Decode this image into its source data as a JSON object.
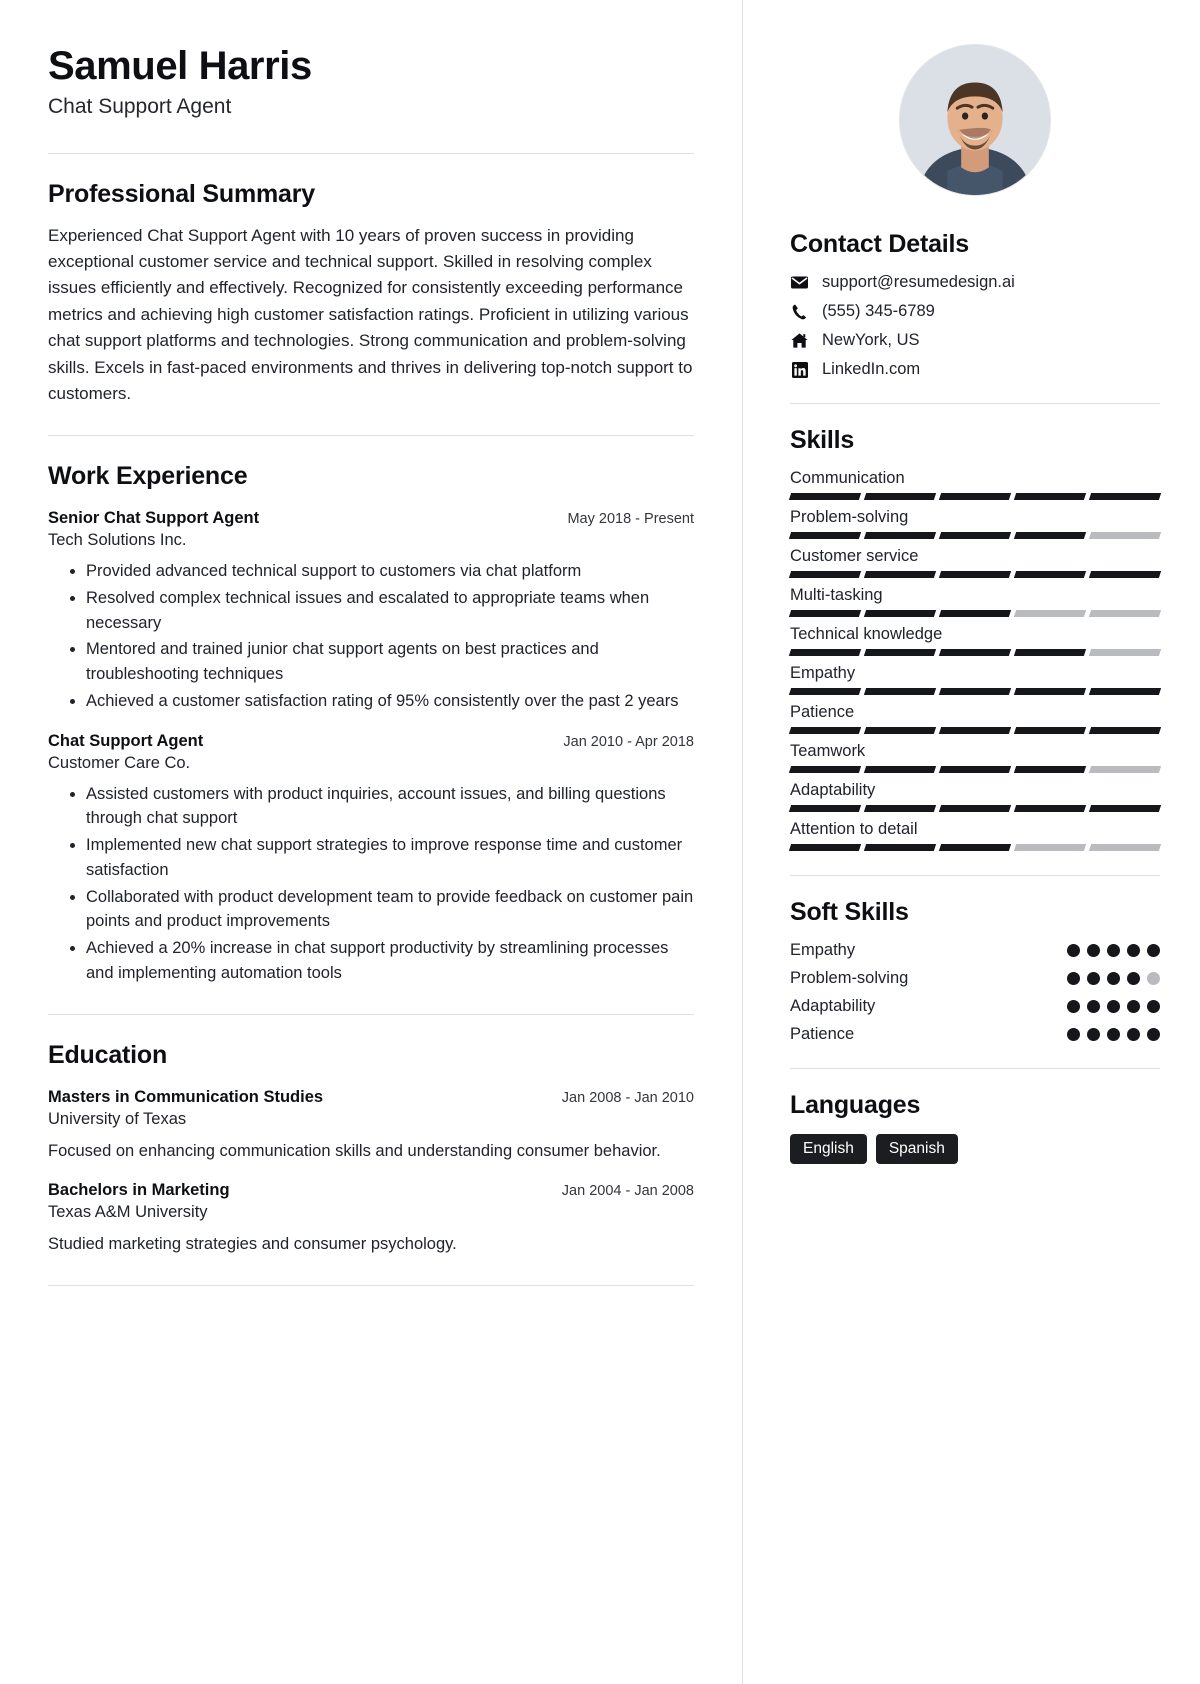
{
  "header": {
    "name": "Samuel Harris",
    "job_title": "Chat Support Agent"
  },
  "summary": {
    "title": "Professional Summary",
    "text": "Experienced Chat Support Agent with 10 years of proven success in providing exceptional customer service and technical support. Skilled in resolving complex issues efficiently and effectively. Recognized for consistently exceeding performance metrics and achieving high customer satisfaction ratings. Proficient in utilizing various chat support platforms and technologies. Strong communication and problem-solving skills. Excels in fast-paced environments and thrives in delivering top-notch support to customers."
  },
  "experience": {
    "title": "Work Experience",
    "entries": [
      {
        "role": "Senior Chat Support Agent",
        "date": "May 2018 - Present",
        "organization": "Tech Solutions Inc.",
        "bullets": [
          "Provided advanced technical support to customers via chat platform",
          "Resolved complex technical issues and escalated to appropriate teams when necessary",
          "Mentored and trained junior chat support agents on best practices and troubleshooting techniques",
          "Achieved a customer satisfaction rating of 95% consistently over the past 2 years"
        ]
      },
      {
        "role": "Chat Support Agent",
        "date": "Jan 2010 - Apr 2018",
        "organization": "Customer Care Co.",
        "bullets": [
          "Assisted customers with product inquiries, account issues, and billing questions through chat support",
          "Implemented new chat support strategies to improve response time and customer satisfaction",
          "Collaborated with product development team to provide feedback on customer pain points and product improvements",
          "Achieved a 20% increase in chat support productivity by streamlining processes and implementing automation tools"
        ]
      }
    ]
  },
  "education": {
    "title": "Education",
    "entries": [
      {
        "degree": "Masters in Communication Studies",
        "date": "Jan 2008 - Jan 2010",
        "school": "University of Texas",
        "description": "Focused on enhancing communication skills and understanding consumer behavior."
      },
      {
        "degree": "Bachelors in Marketing",
        "date": "Jan 2004 - Jan 2008",
        "school": "Texas A&M University",
        "description": "Studied marketing strategies and consumer psychology."
      }
    ]
  },
  "contact": {
    "title": "Contact Details",
    "items": [
      {
        "icon": "envelope-icon",
        "value": "support@resumedesign.ai"
      },
      {
        "icon": "phone-icon",
        "value": "(555) 345-6789"
      },
      {
        "icon": "home-icon",
        "value": "NewYork, US"
      },
      {
        "icon": "linkedin-icon",
        "value": "LinkedIn.com"
      }
    ]
  },
  "skills": {
    "title": "Skills",
    "max": 5,
    "items": [
      {
        "label": "Communication",
        "level": 5
      },
      {
        "label": "Problem-solving",
        "level": 4
      },
      {
        "label": "Customer service",
        "level": 5
      },
      {
        "label": "Multi-tasking",
        "level": 3
      },
      {
        "label": "Technical knowledge",
        "level": 4
      },
      {
        "label": "Empathy",
        "level": 5
      },
      {
        "label": "Patience",
        "level": 5
      },
      {
        "label": "Teamwork",
        "level": 4
      },
      {
        "label": "Adaptability",
        "level": 5
      },
      {
        "label": "Attention to detail",
        "level": 3
      }
    ]
  },
  "soft_skills": {
    "title": "Soft Skills",
    "max": 5,
    "items": [
      {
        "label": "Empathy",
        "level": 5
      },
      {
        "label": "Problem-solving",
        "level": 4
      },
      {
        "label": "Adaptability",
        "level": 5
      },
      {
        "label": "Patience",
        "level": 5
      }
    ]
  },
  "languages": {
    "title": "Languages",
    "items": [
      "English",
      "Spanish"
    ]
  },
  "colors": {
    "text": "#20232a",
    "heading": "#0d0f12",
    "filled": "#15171a",
    "empty": "#b9bbbe",
    "rule": "#dfe1e4"
  }
}
